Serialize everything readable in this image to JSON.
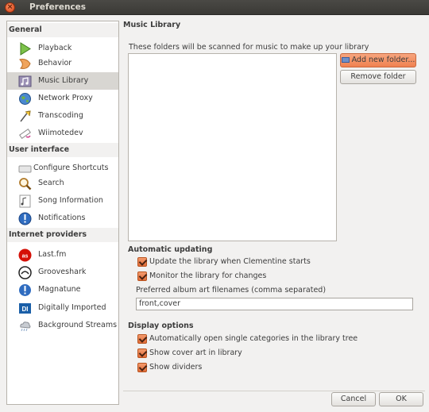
{
  "window": {
    "title": "Preferences"
  },
  "sidebar": {
    "groups": [
      {
        "label": "General",
        "items": [
          {
            "label": "Playback",
            "icon": "play-icon"
          },
          {
            "label": "Behavior",
            "icon": "behavior-icon"
          },
          {
            "label": "Music Library",
            "icon": "music-library-icon",
            "selected": true
          },
          {
            "label": "Network Proxy",
            "icon": "globe-icon"
          },
          {
            "label": "Transcoding",
            "icon": "transcoding-icon"
          },
          {
            "label": "Wiimotedev",
            "icon": "wiimote-icon"
          }
        ]
      },
      {
        "label": "User interface",
        "items": [
          {
            "label": "Configure Shortcuts",
            "icon": "keyboard-icon"
          },
          {
            "label": "Search",
            "icon": "search-icon"
          },
          {
            "label": "Song Information",
            "icon": "song-info-icon"
          },
          {
            "label": "Notifications",
            "icon": "info-icon"
          }
        ]
      },
      {
        "label": "Internet providers",
        "items": [
          {
            "label": "Last.fm",
            "icon": "lastfm-icon"
          },
          {
            "label": "Grooveshark",
            "icon": "grooveshark-icon"
          },
          {
            "label": "Magnatune",
            "icon": "magnatune-icon"
          },
          {
            "label": "Digitally Imported",
            "icon": "di-icon"
          },
          {
            "label": "Background Streams",
            "icon": "cloud-icon"
          }
        ]
      }
    ]
  },
  "main": {
    "title": "Music Library",
    "folders_description": "These folders will be scanned for music to make up your library",
    "add_folder_label": "Add new folder...",
    "remove_folder_label": "Remove folder",
    "auto_update_title": "Automatic updating",
    "update_on_start_label": "Update the library when Clementine starts",
    "monitor_label": "Monitor the library for changes",
    "album_art_label": "Preferred album art filenames (comma separated)",
    "album_art_value": "front,cover",
    "display_title": "Display options",
    "auto_open_label": "Automatically open single categories in the library tree",
    "cover_art_label": "Show cover art in library",
    "dividers_label": "Show dividers"
  },
  "footer": {
    "cancel_label": "Cancel",
    "ok_label": "OK"
  },
  "colors": {
    "accent": "#f07746",
    "selected_row": "#d8d6d2",
    "titlebar": "#3c3b37"
  }
}
